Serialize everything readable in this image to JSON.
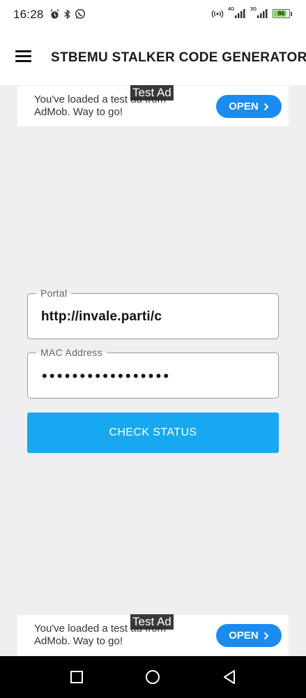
{
  "status_bar": {
    "time": "16:28",
    "network_left": "4G",
    "network_right": "3G",
    "battery_level": "86",
    "battery_fraction": 0.86,
    "icons_left": [
      "alarm-icon",
      "bluetooth-icon",
      "whatsapp-icon"
    ],
    "icons_right": [
      "hotspot-icon",
      "signal-4g-icon",
      "signal-3g-icon",
      "battery-icon"
    ]
  },
  "app_bar": {
    "title": "STBEMU STALKER CODE GENERATOR",
    "menu_icon": "hamburger-menu-icon"
  },
  "ads": {
    "top": {
      "label": "Test Ad",
      "text": "You've loaded a test ad from AdMob. Way to go!",
      "button": "OPEN"
    },
    "bottom": {
      "label": "Test Ad",
      "text": "You've loaded a test ad from AdMob. Way to go!",
      "button": "OPEN"
    }
  },
  "form": {
    "portal": {
      "label": "Portal",
      "value": "http://invale.parti/c"
    },
    "mac": {
      "label": "MAC Address",
      "value": "•••••••••••••••••"
    },
    "check_button": "CHECK STATUS"
  },
  "colors": {
    "accent": "#18a8f1",
    "ad_button": "#1a8cf0",
    "background": "#efeff1"
  },
  "nav_bar": {
    "icons": [
      "recent-apps-icon",
      "home-icon",
      "back-icon"
    ]
  }
}
